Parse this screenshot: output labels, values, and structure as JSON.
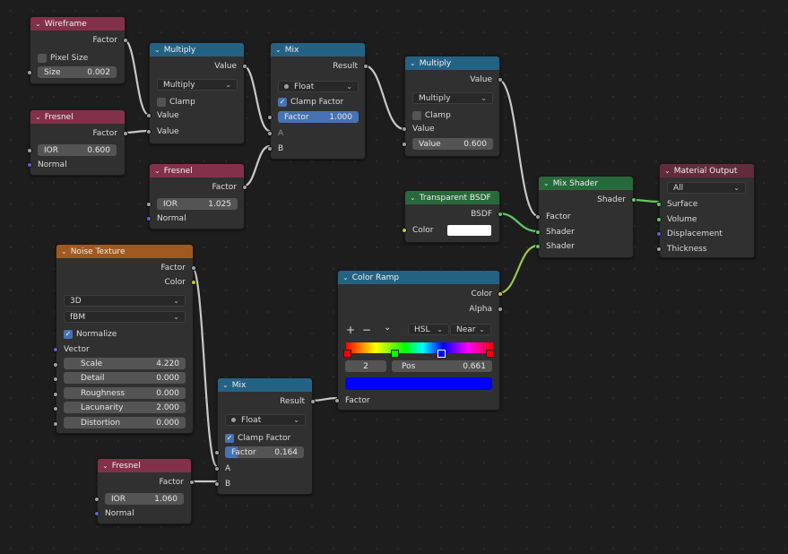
{
  "wireframe": {
    "title": "Wireframe",
    "out_factor": "Factor",
    "pixel_size": "Pixel Size",
    "size_label": "Size",
    "size_value": "0.002"
  },
  "fresnel1": {
    "title": "Fresnel",
    "out_factor": "Factor",
    "ior_label": "IOR",
    "ior_value": "0.600",
    "normal": "Normal"
  },
  "multiply1": {
    "title": "Multiply",
    "out_value": "Value",
    "op": "Multiply",
    "clamp": "Clamp",
    "in_value_a": "Value",
    "in_value_b": "Value"
  },
  "fresnel2": {
    "title": "Fresnel",
    "out_factor": "Factor",
    "ior_label": "IOR",
    "ior_value": "1.025",
    "normal": "Normal"
  },
  "mix1": {
    "title": "Mix",
    "out_result": "Result",
    "type": "Float",
    "clamp_factor": "Clamp Factor",
    "factor_label": "Factor",
    "factor_value": "1.000",
    "in_a": "A",
    "in_b": "B"
  },
  "multiply2": {
    "title": "Multiply",
    "out_value": "Value",
    "op": "Multiply",
    "clamp": "Clamp",
    "in_value": "Value",
    "value_label": "Value",
    "value_value": "0.600"
  },
  "transparent": {
    "title": "Transparent BSDF",
    "out_bsdf": "BSDF",
    "color_label": "Color",
    "color_hex": "#ffffff"
  },
  "mix_shader": {
    "title": "Mix Shader",
    "out_shader": "Shader",
    "in_factor": "Factor",
    "in_shader_a": "Shader",
    "in_shader_b": "Shader"
  },
  "material_output": {
    "title": "Material Output",
    "target": "All",
    "surface": "Surface",
    "volume": "Volume",
    "displacement": "Displacement",
    "thickness": "Thickness"
  },
  "noise": {
    "title": "Noise Texture",
    "out_factor": "Factor",
    "out_color": "Color",
    "dimensions": "3D",
    "noise_type": "fBM",
    "normalize": "Normalize",
    "vector": "Vector",
    "params": [
      {
        "label": "Scale",
        "value": "4.220"
      },
      {
        "label": "Detail",
        "value": "0.000"
      },
      {
        "label": "Roughness",
        "value": "0.000"
      },
      {
        "label": "Lacunarity",
        "value": "2.000"
      },
      {
        "label": "Distortion",
        "value": "0.000"
      }
    ]
  },
  "color_ramp": {
    "title": "Color Ramp",
    "out_color": "Color",
    "out_alpha": "Alpha",
    "plus": "+",
    "minus": "−",
    "chevron": "⌄",
    "color_mode": "HSL",
    "interpolation": "Near",
    "stop_index": "2",
    "pos_label": "Pos",
    "pos_value": "0.661",
    "in_factor": "Factor",
    "selected_color": "#0000ff"
  },
  "mix2": {
    "title": "Mix",
    "out_result": "Result",
    "type": "Float",
    "clamp_factor": "Clamp Factor",
    "factor_label": "Factor",
    "factor_value": "0.164",
    "factor_fraction": 0.164,
    "in_a": "A",
    "in_b": "B"
  },
  "fresnel3": {
    "title": "Fresnel",
    "out_factor": "Factor",
    "ior_label": "IOR",
    "ior_value": "1.060",
    "normal": "Normal"
  }
}
